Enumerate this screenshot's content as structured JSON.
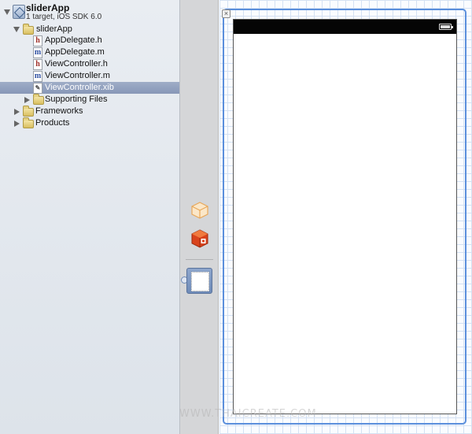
{
  "navigator": {
    "project": {
      "name": "sliderApp",
      "subtitle": "1 target, iOS SDK 6.0",
      "icon": "xcode-project-icon"
    },
    "items": [
      {
        "label": "sliderApp",
        "icon": "folder-icon",
        "expanded": true
      },
      {
        "label": "AppDelegate.h",
        "icon": "h-file-icon",
        "glyph": "h"
      },
      {
        "label": "AppDelegate.m",
        "icon": "m-file-icon",
        "glyph": "m"
      },
      {
        "label": "ViewController.h",
        "icon": "h-file-icon",
        "glyph": "h"
      },
      {
        "label": "ViewController.m",
        "icon": "m-file-icon",
        "glyph": "m"
      },
      {
        "label": "ViewController.xib",
        "icon": "xib-file-icon",
        "selected": true
      },
      {
        "label": "Supporting Files",
        "icon": "folder-icon",
        "expanded": false
      },
      {
        "label": "Frameworks",
        "icon": "folder-icon",
        "expanded": false
      },
      {
        "label": "Products",
        "icon": "folder-icon",
        "expanded": false
      }
    ]
  },
  "dock": {
    "objects": [
      "files-owner-cube-icon",
      "first-responder-cube-icon",
      "view-object-icon"
    ]
  },
  "canvas": {
    "close_glyph": "×",
    "accent": "#5b8fdc"
  },
  "watermark": "WWW.THAICREATE.COM"
}
